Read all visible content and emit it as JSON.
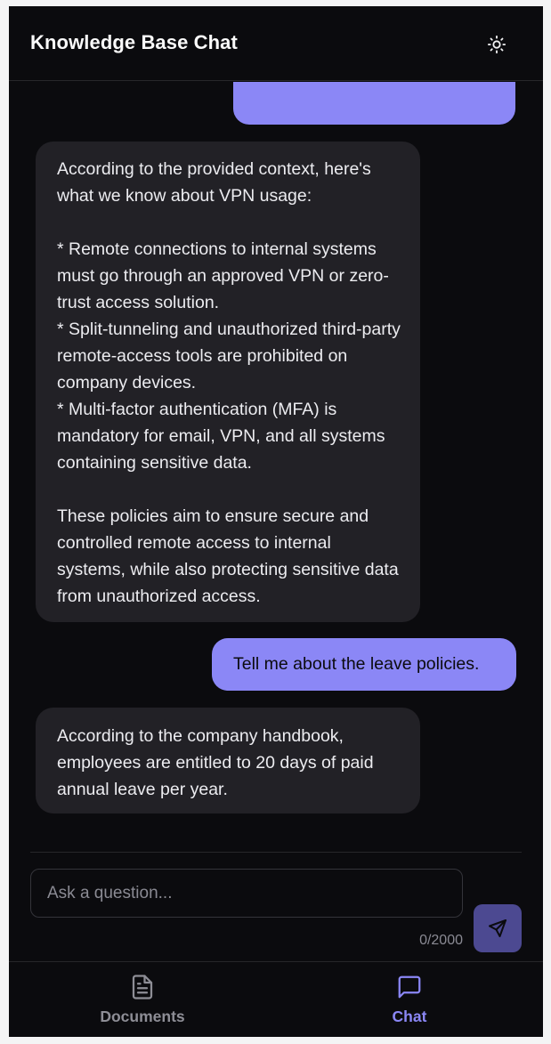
{
  "header": {
    "title": "Knowledge Base Chat",
    "theme_icon": "sun-icon"
  },
  "messages": [
    {
      "role": "user",
      "text": ""
    },
    {
      "role": "assistant",
      "text": "According to the provided context, here's what we know about VPN usage:\n\n* Remote connections to internal systems must go through an approved VPN or zero-trust access solution.\n* Split-tunneling and unauthorized third-party remote-access tools are prohibited on company devices.\n* Multi-factor authentication (MFA) is mandatory for email, VPN, and all systems containing sensitive data.\n\nThese policies aim to ensure secure and controlled remote access to internal systems, while also protecting sensitive data from unauthorized access."
    },
    {
      "role": "user",
      "text": "Tell me about the leave policies."
    },
    {
      "role": "assistant",
      "text": "According to the company handbook, employees are entitled to 20 days of paid annual leave per year."
    }
  ],
  "composer": {
    "placeholder": "Ask a question...",
    "value": "",
    "char_count": "0/2000",
    "send_icon": "send-icon"
  },
  "bottom_nav": {
    "items": [
      {
        "label": "Documents",
        "icon": "document-icon",
        "active": false
      },
      {
        "label": "Chat",
        "icon": "chat-bubble-icon",
        "active": true
      }
    ]
  },
  "colors": {
    "accent": "#8b87f6",
    "background": "#0b0b0e",
    "assistant_bubble": "#222126",
    "send_button": "#4c4991"
  }
}
